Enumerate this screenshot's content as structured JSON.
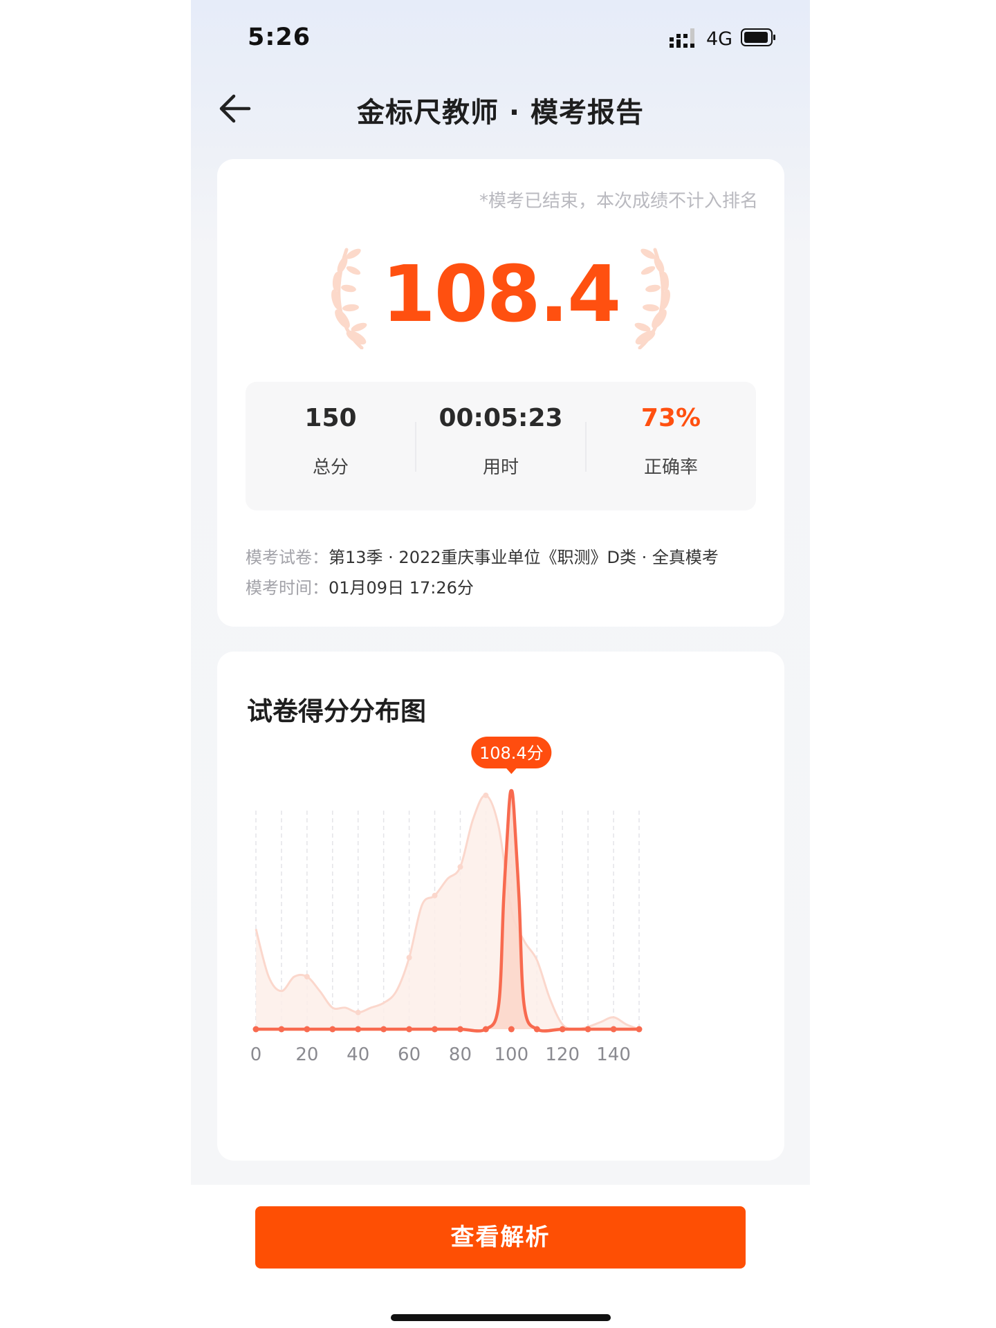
{
  "status_bar": {
    "time": "5:26",
    "network": "4G"
  },
  "nav": {
    "title": "金标尺教师 · 模考报告"
  },
  "report": {
    "notice": "*模考已结束，本次成绩不计入排名",
    "score": "108.4",
    "stats": [
      {
        "value": "150",
        "label": "总分"
      },
      {
        "value": "00:05:23",
        "label": "用时"
      },
      {
        "value": "73%",
        "label": "正确率"
      }
    ],
    "stats_accent": "#ff5010",
    "paper_label": "模考试卷：",
    "paper_value": "第13季 · 2022重庆事业单位《职测》D类 · 全真模考",
    "time_label": "模考时间：",
    "time_value": "01月09日 17:26分"
  },
  "chart_section": {
    "title": "试卷得分分布图"
  },
  "chart_data": {
    "type": "area",
    "title": "试卷得分分布图",
    "xlabel": "",
    "ylabel": "",
    "xlim": [
      0,
      150
    ],
    "ylim": [
      0,
      1
    ],
    "x_ticks": [
      0,
      20,
      40,
      60,
      80,
      100,
      120,
      140
    ],
    "grid": "vertical dashed every 10",
    "series": [
      {
        "role": "all-test-takers",
        "x": [
          0,
          5,
          10,
          15,
          20,
          25,
          30,
          35,
          40,
          45,
          50,
          55,
          60,
          65,
          70,
          75,
          80,
          85,
          90,
          95,
          100,
          105,
          110,
          115,
          120,
          125,
          130,
          135,
          140,
          145,
          150
        ],
        "values": [
          0.42,
          0.22,
          0.16,
          0.22,
          0.22,
          0.16,
          0.09,
          0.09,
          0.07,
          0.09,
          0.11,
          0.16,
          0.3,
          0.52,
          0.56,
          0.63,
          0.68,
          0.88,
          0.98,
          0.85,
          0.5,
          0.37,
          0.29,
          0.13,
          0.02,
          0.0,
          0.01,
          0.03,
          0.05,
          0.02,
          0.0
        ]
      },
      {
        "role": "my-score",
        "x": [
          0,
          10,
          20,
          30,
          40,
          50,
          60,
          70,
          80,
          90,
          95,
          97,
          99,
          100,
          101,
          103,
          105,
          110,
          120,
          130,
          140,
          150
        ],
        "values": [
          0,
          0,
          0,
          0,
          0,
          0,
          0,
          0,
          0,
          0,
          0.1,
          0.55,
          0.92,
          1.0,
          0.92,
          0.55,
          0.1,
          0,
          0,
          0,
          0,
          0
        ]
      }
    ],
    "marker": {
      "x": 100,
      "label": "108.4分"
    },
    "colors": {
      "line": "#f86a4f",
      "area": "#fde5de",
      "tooltip": "#ff4d0f"
    }
  },
  "actions": {
    "primary_label": "查看解析"
  }
}
